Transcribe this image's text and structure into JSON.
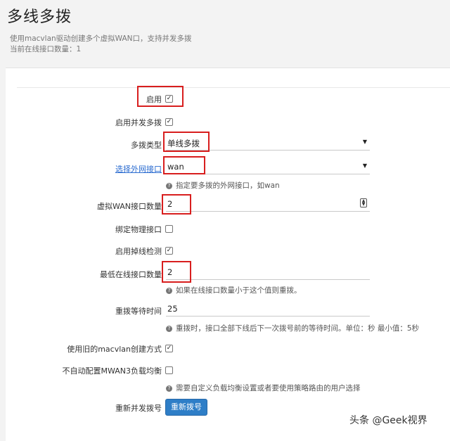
{
  "page": {
    "title": "多线多拨",
    "desc1": "使用macvlan驱动创建多个虚拟WAN口，支持并发多拨",
    "desc2": "当前在线接口数量：1"
  },
  "form": {
    "enable": {
      "label": "启用",
      "checked": true
    },
    "concurrent": {
      "label": "启用并发多拨",
      "checked": true
    },
    "dial_type": {
      "label": "多拨类型",
      "value": "单线多拨"
    },
    "ext_iface": {
      "label": "选择外网接口",
      "value": "wan",
      "hint": "指定要多拨的外网接口，如wan"
    },
    "vwan_count": {
      "label": "虚拟WAN接口数量",
      "value": "2"
    },
    "bind_phys": {
      "label": "绑定物理接口",
      "checked": false
    },
    "drop_detect": {
      "label": "启用掉线检测",
      "checked": true
    },
    "min_online": {
      "label": "最低在线接口数量",
      "value": "2",
      "hint": "如果在线接口数量小于这个值则重拨。"
    },
    "redial_wait": {
      "label": "重拨等待时间",
      "value": "25",
      "hint": "重拨时，接口全部下线后下一次拨号前的等待时间。单位：秒 最小值：5秒"
    },
    "old_macvlan": {
      "label": "使用旧的macvlan创建方式",
      "checked": true
    },
    "no_mwan3": {
      "label": "不自动配置MWAN3负载均衡",
      "checked": false,
      "hint": "需要自定义负载均衡设置或者要使用策略路由的用户选择"
    },
    "redial": {
      "label": "重新并发拨号",
      "button": "重新拨号"
    }
  },
  "watermark": "头条 @Geek视界",
  "colors": {
    "highlight": "#d81e1e",
    "button": "#2e7ec7",
    "link": "#2a6bd0"
  }
}
